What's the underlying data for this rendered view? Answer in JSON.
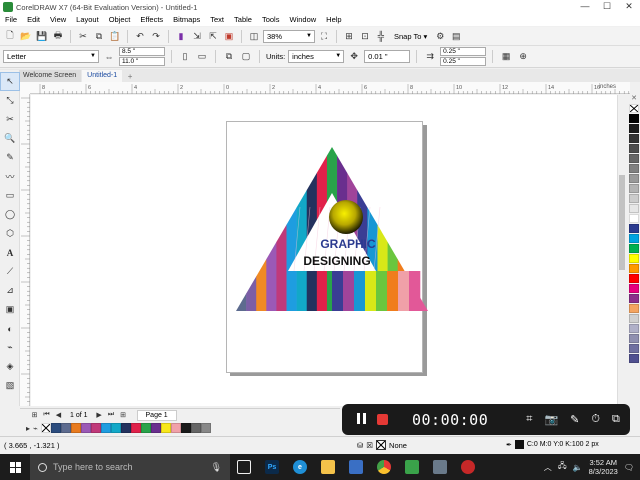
{
  "window": {
    "title": "CorelDRAW X7 (64-Bit Evaluation Version) - Untitled-1",
    "controls": [
      "—",
      "☐",
      "✕"
    ]
  },
  "menu": [
    "File",
    "Edit",
    "View",
    "Layout",
    "Object",
    "Effects",
    "Bitmaps",
    "Text",
    "Table",
    "Tools",
    "Window",
    "Help"
  ],
  "toolbar": {
    "zoom": "38%",
    "snap_to": "Snap To"
  },
  "property_bar": {
    "page_size": "Letter",
    "width": "8.5 \"",
    "height": "11.0 \"",
    "units_label": "Units:",
    "units": "inches",
    "nudge": "0.01 \"",
    "dup_x": "0.25 \"",
    "dup_y": "0.25 \""
  },
  "tabs": [
    {
      "label": "Welcome Screen",
      "active": false
    },
    {
      "label": "Untitled-1",
      "active": true
    }
  ],
  "ruler": {
    "unit": "inches",
    "ticks": [
      "8",
      "6",
      "4",
      "2",
      "0",
      "2",
      "4",
      "6",
      "8",
      "10",
      "12",
      "14",
      "16"
    ]
  },
  "artwork": {
    "line1": "GRAPHIC",
    "line2": "DESIGNING",
    "line1_color": "#2b3a8f",
    "line2_color": "#111111",
    "stripe_colors": [
      "#5d6b8f",
      "#7b5ea6",
      "#f08a24",
      "#9b59b6",
      "#c0397a",
      "#1e9de0",
      "#12a8c8",
      "#23325e",
      "#e0214a",
      "#29a34a",
      "#6a2f8e",
      "#a0449a",
      "#3a3d94",
      "#1897d4",
      "#d8e818",
      "#6ac63e",
      "#f07d1c",
      "#f0a0a8",
      "#e25898"
    ]
  },
  "page_nav": {
    "counter": "1 of 1",
    "page_tab": "Page 1"
  },
  "status": {
    "coords": "( 3.665 , -1.321 )",
    "fill": "None",
    "outline": "C:0 M:0 Y:0 K:100  2 px"
  },
  "recorder": {
    "time": "00:00:00"
  },
  "taskbar": {
    "search_placeholder": "Type here to search",
    "time": "3:52 AM",
    "date": "8/3/2023"
  },
  "palette_colors": [
    "#000000",
    "#1a1a1a",
    "#333333",
    "#4d4d4d",
    "#666666",
    "#808080",
    "#999999",
    "#b3b3b3",
    "#cccccc",
    "#e6e6e6",
    "#ffffff",
    "#2b3a8f",
    "#00a3e0",
    "#00b050",
    "#ffff00",
    "#ff9900",
    "#ff0000",
    "#e6007e",
    "#8b2f8b",
    "#f4a460",
    "#d0d0d0",
    "#b0b0c8",
    "#9090b0",
    "#7070a0",
    "#505090"
  ],
  "doc_palette_colors": [
    "#2b4c7e",
    "#5d6b8f",
    "#e87b1f",
    "#9b59b6",
    "#c0397a",
    "#1e9de0",
    "#12a8c8",
    "#23325e",
    "#e0214a",
    "#29a34a",
    "#6a2f8e",
    "#f8e71c",
    "#f0a0a8",
    "#1a1a1a",
    "#666666",
    "#888888"
  ]
}
